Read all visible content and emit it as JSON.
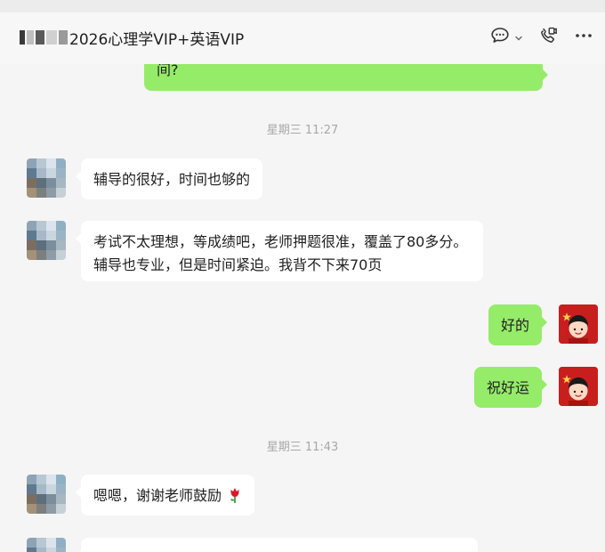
{
  "chat": {
    "title": "2026心理学VIP+英语VIP"
  },
  "icons": {
    "chat": "chat-bubble-icon",
    "chevron": "chevron-down-icon",
    "call": "video-call-icon",
    "more": "more-icon"
  },
  "messages": {
    "m0": {
      "text": "间?"
    },
    "m1": {
      "text": "辅导的很好，时间也够的"
    },
    "m2": {
      "text": "考试不太理想，等成绩吧，老师押题很准，覆盖了80多分。辅导也专业，但是时间紧迫。我背不下来70页"
    },
    "m3": {
      "text": "好的"
    },
    "m4": {
      "text": "祝好运"
    },
    "m5": {
      "text": "嗯嗯，谢谢老师鼓励"
    }
  },
  "timestamps": {
    "t1": "星期三 11:27",
    "t2": "星期三 11:43"
  },
  "colors": {
    "out_bubble": "#95ec69",
    "in_bubble": "#ffffff",
    "background": "#f5f5f5"
  }
}
